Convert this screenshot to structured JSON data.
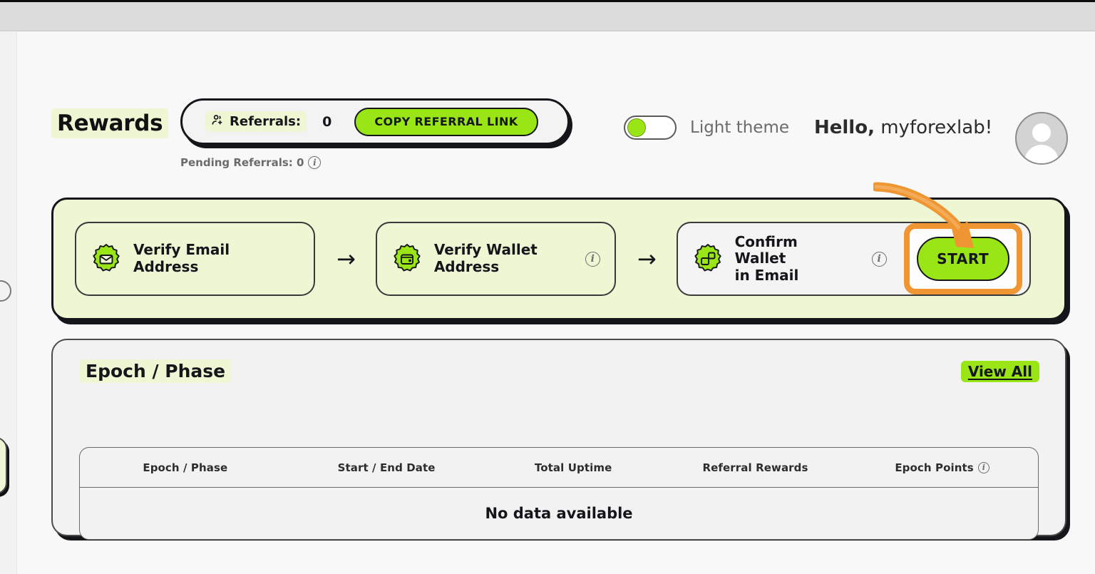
{
  "brand": {
    "accent_green": "#9ae515",
    "pale_green": "#eef6d4",
    "ink": "#14161a",
    "highlight_orange": "#ef9531"
  },
  "header": {
    "page_title": "Rewards",
    "referrals_label": "Referrals:",
    "referrals_count": "0",
    "copy_referral_label": "COPY REFERRAL LINK",
    "pending_referrals": "Pending Referrals: 0",
    "theme_label": "Light theme",
    "greeting_hello": "Hello,",
    "greeting_user": "myforexlab!",
    "icons": {
      "referrals": "person-add-icon",
      "pending_info": "info-icon",
      "avatar": "avatar-icon",
      "theme_toggle": "theme-toggle-switch"
    }
  },
  "steps": {
    "items": [
      {
        "label": "Verify Email\nAddress",
        "icon": "email-verified-badge-icon",
        "has_info": false,
        "state": "transparent"
      },
      {
        "label": "Verify Wallet\nAddress",
        "icon": "wallet-verified-badge-icon",
        "has_info": true,
        "state": "transparent"
      },
      {
        "label": "Confirm Wallet\nin Email",
        "icon": "confirm-wallet-badge-icon",
        "has_info": true,
        "state": "active"
      }
    ],
    "separator": "→",
    "start_label": "START"
  },
  "epoch": {
    "title": "Epoch / Phase",
    "view_all_label": "View All",
    "columns": [
      {
        "label": "Epoch / Phase",
        "info": false
      },
      {
        "label": "Start / End Date",
        "info": false
      },
      {
        "label": "Total Uptime",
        "info": false
      },
      {
        "label": "Referral Rewards",
        "info": false
      },
      {
        "label": "Epoch Points",
        "info": true
      }
    ],
    "rows": [],
    "empty_message": "No data available"
  }
}
